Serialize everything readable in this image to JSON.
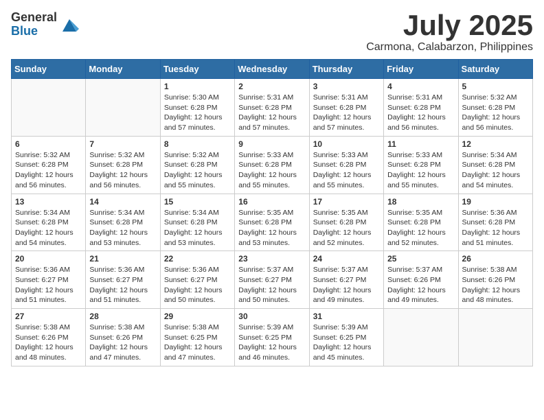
{
  "header": {
    "logo_general": "General",
    "logo_blue": "Blue",
    "month": "July 2025",
    "location": "Carmona, Calabarzon, Philippines"
  },
  "weekdays": [
    "Sunday",
    "Monday",
    "Tuesday",
    "Wednesday",
    "Thursday",
    "Friday",
    "Saturday"
  ],
  "weeks": [
    [
      {
        "day": "",
        "sunrise": "",
        "sunset": "",
        "daylight": ""
      },
      {
        "day": "",
        "sunrise": "",
        "sunset": "",
        "daylight": ""
      },
      {
        "day": "1",
        "sunrise": "Sunrise: 5:30 AM",
        "sunset": "Sunset: 6:28 PM",
        "daylight": "Daylight: 12 hours and 57 minutes."
      },
      {
        "day": "2",
        "sunrise": "Sunrise: 5:31 AM",
        "sunset": "Sunset: 6:28 PM",
        "daylight": "Daylight: 12 hours and 57 minutes."
      },
      {
        "day": "3",
        "sunrise": "Sunrise: 5:31 AM",
        "sunset": "Sunset: 6:28 PM",
        "daylight": "Daylight: 12 hours and 57 minutes."
      },
      {
        "day": "4",
        "sunrise": "Sunrise: 5:31 AM",
        "sunset": "Sunset: 6:28 PM",
        "daylight": "Daylight: 12 hours and 56 minutes."
      },
      {
        "day": "5",
        "sunrise": "Sunrise: 5:32 AM",
        "sunset": "Sunset: 6:28 PM",
        "daylight": "Daylight: 12 hours and 56 minutes."
      }
    ],
    [
      {
        "day": "6",
        "sunrise": "Sunrise: 5:32 AM",
        "sunset": "Sunset: 6:28 PM",
        "daylight": "Daylight: 12 hours and 56 minutes."
      },
      {
        "day": "7",
        "sunrise": "Sunrise: 5:32 AM",
        "sunset": "Sunset: 6:28 PM",
        "daylight": "Daylight: 12 hours and 56 minutes."
      },
      {
        "day": "8",
        "sunrise": "Sunrise: 5:32 AM",
        "sunset": "Sunset: 6:28 PM",
        "daylight": "Daylight: 12 hours and 55 minutes."
      },
      {
        "day": "9",
        "sunrise": "Sunrise: 5:33 AM",
        "sunset": "Sunset: 6:28 PM",
        "daylight": "Daylight: 12 hours and 55 minutes."
      },
      {
        "day": "10",
        "sunrise": "Sunrise: 5:33 AM",
        "sunset": "Sunset: 6:28 PM",
        "daylight": "Daylight: 12 hours and 55 minutes."
      },
      {
        "day": "11",
        "sunrise": "Sunrise: 5:33 AM",
        "sunset": "Sunset: 6:28 PM",
        "daylight": "Daylight: 12 hours and 55 minutes."
      },
      {
        "day": "12",
        "sunrise": "Sunrise: 5:34 AM",
        "sunset": "Sunset: 6:28 PM",
        "daylight": "Daylight: 12 hours and 54 minutes."
      }
    ],
    [
      {
        "day": "13",
        "sunrise": "Sunrise: 5:34 AM",
        "sunset": "Sunset: 6:28 PM",
        "daylight": "Daylight: 12 hours and 54 minutes."
      },
      {
        "day": "14",
        "sunrise": "Sunrise: 5:34 AM",
        "sunset": "Sunset: 6:28 PM",
        "daylight": "Daylight: 12 hours and 53 minutes."
      },
      {
        "day": "15",
        "sunrise": "Sunrise: 5:34 AM",
        "sunset": "Sunset: 6:28 PM",
        "daylight": "Daylight: 12 hours and 53 minutes."
      },
      {
        "day": "16",
        "sunrise": "Sunrise: 5:35 AM",
        "sunset": "Sunset: 6:28 PM",
        "daylight": "Daylight: 12 hours and 53 minutes."
      },
      {
        "day": "17",
        "sunrise": "Sunrise: 5:35 AM",
        "sunset": "Sunset: 6:28 PM",
        "daylight": "Daylight: 12 hours and 52 minutes."
      },
      {
        "day": "18",
        "sunrise": "Sunrise: 5:35 AM",
        "sunset": "Sunset: 6:28 PM",
        "daylight": "Daylight: 12 hours and 52 minutes."
      },
      {
        "day": "19",
        "sunrise": "Sunrise: 5:36 AM",
        "sunset": "Sunset: 6:28 PM",
        "daylight": "Daylight: 12 hours and 51 minutes."
      }
    ],
    [
      {
        "day": "20",
        "sunrise": "Sunrise: 5:36 AM",
        "sunset": "Sunset: 6:27 PM",
        "daylight": "Daylight: 12 hours and 51 minutes."
      },
      {
        "day": "21",
        "sunrise": "Sunrise: 5:36 AM",
        "sunset": "Sunset: 6:27 PM",
        "daylight": "Daylight: 12 hours and 51 minutes."
      },
      {
        "day": "22",
        "sunrise": "Sunrise: 5:36 AM",
        "sunset": "Sunset: 6:27 PM",
        "daylight": "Daylight: 12 hours and 50 minutes."
      },
      {
        "day": "23",
        "sunrise": "Sunrise: 5:37 AM",
        "sunset": "Sunset: 6:27 PM",
        "daylight": "Daylight: 12 hours and 50 minutes."
      },
      {
        "day": "24",
        "sunrise": "Sunrise: 5:37 AM",
        "sunset": "Sunset: 6:27 PM",
        "daylight": "Daylight: 12 hours and 49 minutes."
      },
      {
        "day": "25",
        "sunrise": "Sunrise: 5:37 AM",
        "sunset": "Sunset: 6:26 PM",
        "daylight": "Daylight: 12 hours and 49 minutes."
      },
      {
        "day": "26",
        "sunrise": "Sunrise: 5:38 AM",
        "sunset": "Sunset: 6:26 PM",
        "daylight": "Daylight: 12 hours and 48 minutes."
      }
    ],
    [
      {
        "day": "27",
        "sunrise": "Sunrise: 5:38 AM",
        "sunset": "Sunset: 6:26 PM",
        "daylight": "Daylight: 12 hours and 48 minutes."
      },
      {
        "day": "28",
        "sunrise": "Sunrise: 5:38 AM",
        "sunset": "Sunset: 6:26 PM",
        "daylight": "Daylight: 12 hours and 47 minutes."
      },
      {
        "day": "29",
        "sunrise": "Sunrise: 5:38 AM",
        "sunset": "Sunset: 6:25 PM",
        "daylight": "Daylight: 12 hours and 47 minutes."
      },
      {
        "day": "30",
        "sunrise": "Sunrise: 5:39 AM",
        "sunset": "Sunset: 6:25 PM",
        "daylight": "Daylight: 12 hours and 46 minutes."
      },
      {
        "day": "31",
        "sunrise": "Sunrise: 5:39 AM",
        "sunset": "Sunset: 6:25 PM",
        "daylight": "Daylight: 12 hours and 45 minutes."
      },
      {
        "day": "",
        "sunrise": "",
        "sunset": "",
        "daylight": ""
      },
      {
        "day": "",
        "sunrise": "",
        "sunset": "",
        "daylight": ""
      }
    ]
  ]
}
